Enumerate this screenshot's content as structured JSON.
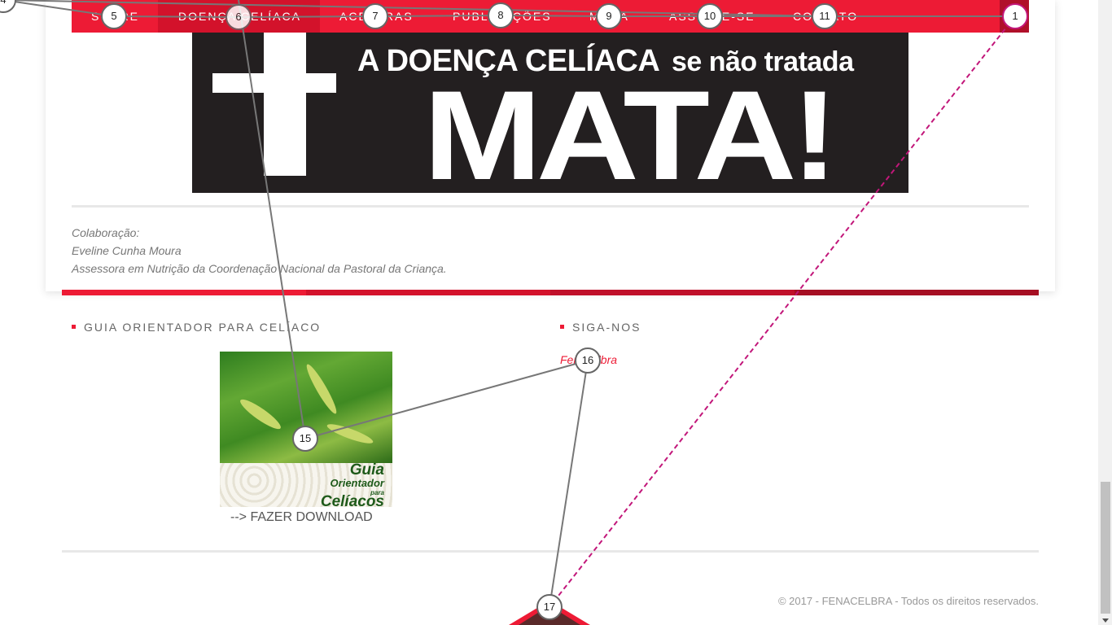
{
  "nav": {
    "items": [
      {
        "label": "Sobre",
        "active": false
      },
      {
        "label": "Doença Celíaca",
        "active": true
      },
      {
        "label": "Acelbras",
        "active": false
      },
      {
        "label": "Publicações",
        "active": false
      },
      {
        "label": "Mídia",
        "active": false
      },
      {
        "label": "Associe-se",
        "active": false
      },
      {
        "label": "Contato",
        "active": false
      }
    ]
  },
  "banner": {
    "line1_part1": "A DOENÇA CELÍACA",
    "line1_part2": "se não tratada",
    "line2": "MATA!"
  },
  "credits": {
    "line1": "Colaboração:",
    "line2": "Eveline Cunha Moura",
    "line3": "Assessora em Nutrição da Coordenação Nacional da Pastoral da Criança."
  },
  "footer_widgets": {
    "guide": {
      "title": "Guia Orientador para Celíaco",
      "image_text": {
        "l1": "Guia",
        "l2": "Orientador",
        "l3": "para",
        "l4": "Celíacos"
      },
      "download_label": "--> FAZER DOWNLOAD"
    },
    "social": {
      "title": "Siga-nos",
      "link_label": "Fenacelbra"
    }
  },
  "copyright": "© 2017 - FENACELBRA - Todos os direitos reservados.",
  "badges": [
    "4",
    "5",
    "6",
    "7",
    "8",
    "9",
    "10",
    "11",
    "1",
    "15",
    "16",
    "17"
  ],
  "colors": {
    "brand_red": "#ed1b35",
    "brand_dark_red": "#b0102a",
    "banner_bg": "#231f20",
    "annotation_pink": "#c2177a"
  }
}
